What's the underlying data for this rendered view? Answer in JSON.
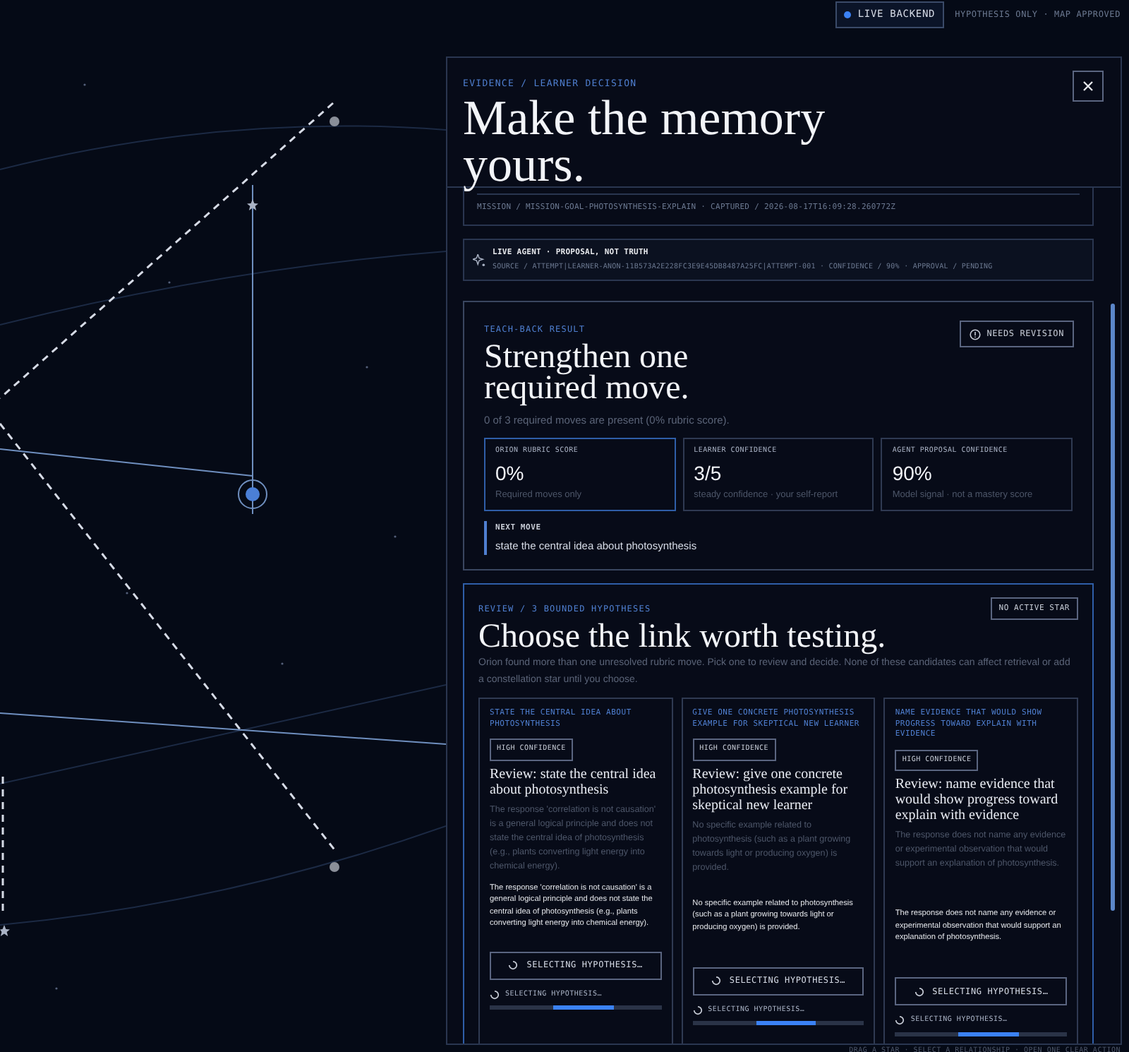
{
  "top_bar": {
    "backend_badge": {
      "label": "LIVE BACKEND",
      "live": true
    },
    "status": "HYPOTHESIS ONLY · MAP APPROVED"
  },
  "panel": {
    "breadcrumb": "EVIDENCE / LEARNER DECISION",
    "title": "Make the memory yours.",
    "mission_line": "MISSION / MISSION-GOAL-PHOTOSYNTHESIS-EXPLAIN · CAPTURED / 2026-08-17T16:09:28.260772Z",
    "agent": {
      "title": "LIVE AGENT · PROPOSAL, NOT TRUTH",
      "source": "SOURCE / ATTEMPT|LEARNER-ANON-11B573A2E228FC3E9E45DB8487A25FC|ATTEMPT-001 · CONFIDENCE / 90% · APPROVAL / PENDING"
    },
    "teach_back": {
      "label": "TEACH-BACK RESULT",
      "title": "Strengthen one required move.",
      "status": "NEEDS REVISION",
      "summary": "0 of 3 required moves are present (0% rubric score).",
      "metrics": [
        {
          "label": "ORION RUBRIC SCORE",
          "value": "0%",
          "note": "Required moves only",
          "highlighted": true
        },
        {
          "label": "LEARNER CONFIDENCE",
          "value": "3/5",
          "note": "steady confidence · your self-report",
          "highlighted": false
        },
        {
          "label": "AGENT PROPOSAL CONFIDENCE",
          "value": "90%",
          "note": "Model signal · not a mastery score",
          "highlighted": false
        }
      ],
      "next_move": {
        "label": "NEXT MOVE",
        "text": "state the central idea about photosynthesis"
      }
    },
    "review": {
      "label": "REVIEW / 3 BOUNDED HYPOTHESES",
      "badge": "NO ACTIVE STAR",
      "title": "Choose the link worth testing.",
      "description": "Orion found more than one unresolved rubric move. Pick one to review and decide. None of these candidates can affect retrieval or add a constellation star until you choose.",
      "hypotheses": [
        {
          "goal": "STATE THE CENTRAL IDEA ABOUT PHOTOSYNTHESIS",
          "confidence": "HIGH CONFIDENCE",
          "heading": "Review: state the central idea about photosynthesis",
          "rationale": "The response 'correlation is not causation' is a general logical principle and does not state the central idea of photosynthesis (e.g., plants converting light energy into chemical energy).",
          "detail": "The response 'correlation is not causation' is a general logical principle and does not state the central idea of photosynthesis (e.g., plants converting light energy into chemical energy).",
          "button": "SELECTING HYPOTHESIS…",
          "status": "SELECTING HYPOTHESIS…"
        },
        {
          "goal": "GIVE ONE CONCRETE PHOTOSYNTHESIS EXAMPLE FOR SKEPTICAL NEW LEARNER",
          "confidence": "HIGH CONFIDENCE",
          "heading": "Review: give one concrete photosynthesis example for skeptical new learner",
          "rationale": "No specific example related to photosynthesis (such as a plant growing towards light or producing oxygen) is provided.",
          "detail": "No specific example related to photosynthesis (such as a plant growing towards light or producing oxygen) is provided.",
          "button": "SELECTING HYPOTHESIS…",
          "status": "SELECTING HYPOTHESIS…"
        },
        {
          "goal": "NAME EVIDENCE THAT WOULD SHOW PROGRESS TOWARD EXPLAIN WITH EVIDENCE",
          "confidence": "HIGH CONFIDENCE",
          "heading": "Review: name evidence that would show progress toward explain with evidence",
          "rationale": "The response does not name any evidence or experimental observation that would support an explanation of photosynthesis.",
          "detail": "The response does not name any evidence or experimental observation that would support an explanation of photosynthesis.",
          "button": "SELECTING HYPOTHESIS…",
          "status": "SELECTING HYPOTHESIS…"
        }
      ]
    }
  },
  "footer_hint": "DRAG A STAR · SELECT A RELATIONSHIP · OPEN ONE CLEAR ACTION"
}
